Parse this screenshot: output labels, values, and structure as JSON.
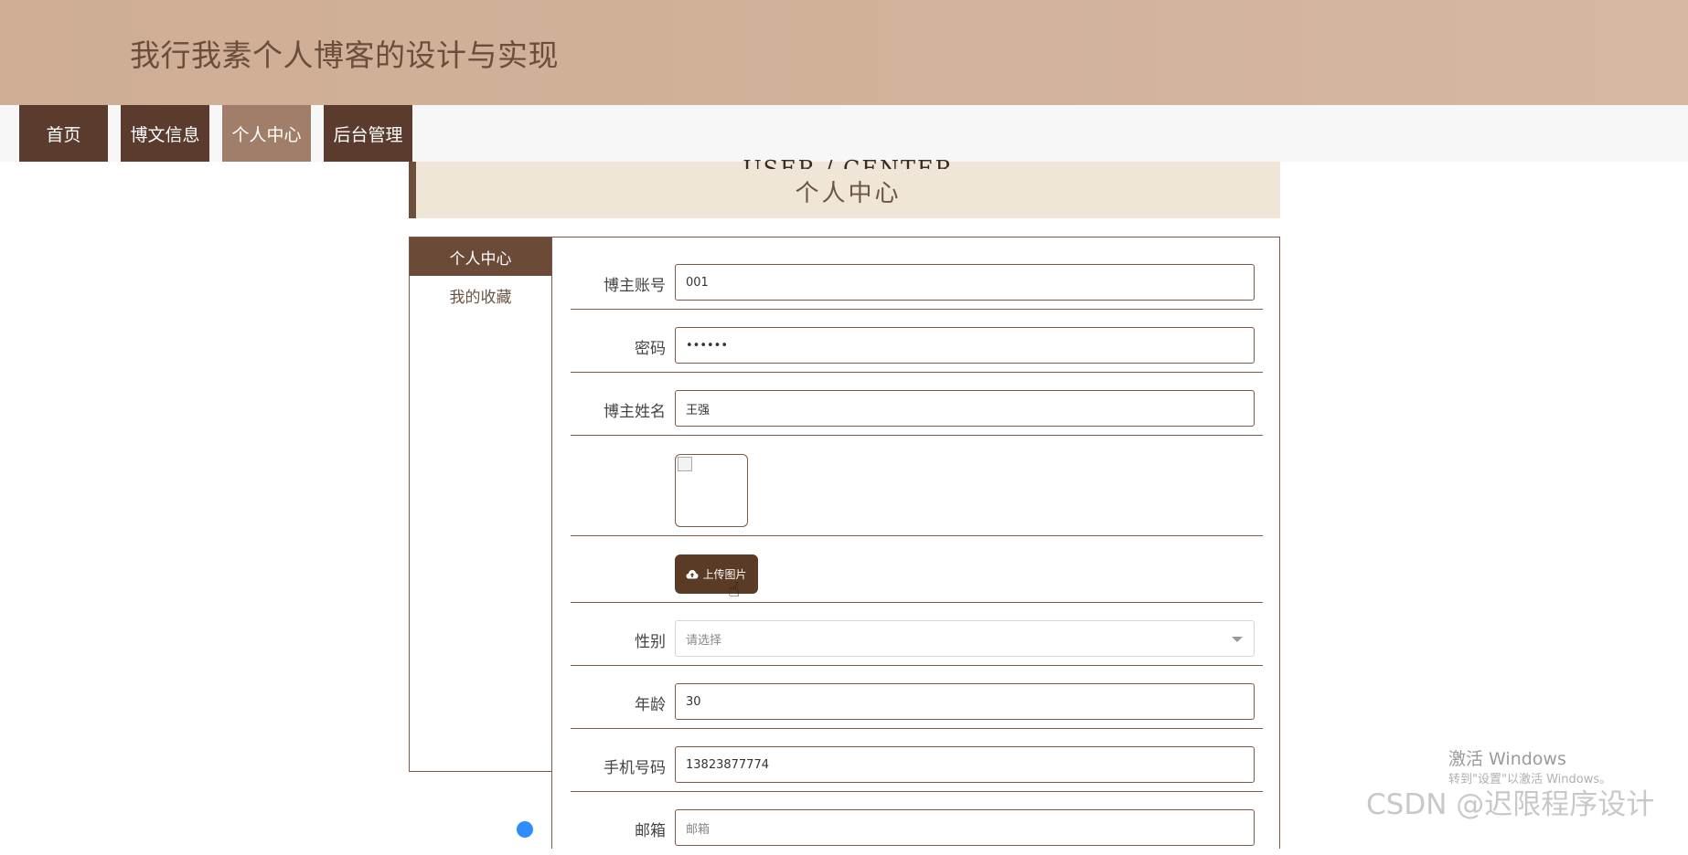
{
  "site_title": "我行我素个人博客的设计与实现",
  "nav": [
    {
      "label": "首页"
    },
    {
      "label": "博文信息"
    },
    {
      "label": "个人中心",
      "active": true
    },
    {
      "label": "后台管理"
    }
  ],
  "section": {
    "ghost_text": "USER / CENTER",
    "title": "个人中心"
  },
  "side_menu": [
    {
      "label": "个人中心",
      "active": true
    },
    {
      "label": "我的收藏"
    }
  ],
  "form": {
    "account": {
      "label": "博主账号",
      "value": "001"
    },
    "password": {
      "label": "密码",
      "value": "••••••"
    },
    "name": {
      "label": "博主姓名",
      "value": "王强"
    },
    "upload_label": "上传图片",
    "gender": {
      "label": "性别",
      "placeholder": "请选择"
    },
    "age": {
      "label": "年龄",
      "value": "30"
    },
    "phone": {
      "label": "手机号码",
      "value": "13823877774"
    },
    "email": {
      "label": "邮箱",
      "placeholder": "邮箱"
    }
  },
  "watermarks": {
    "win_line1": "激活 Windows",
    "win_line2": "转到\"设置\"以激活 Windows。",
    "csdn": "CSDN @迟限程序设计"
  },
  "colors": {
    "accent": "#5a3b2e",
    "active": "#a07e6a",
    "header": "#cfae95"
  },
  "icons": {
    "upload": "cloud-upload-icon",
    "select": "chevron-down-icon",
    "cursor": "hand-pointer-icon"
  }
}
